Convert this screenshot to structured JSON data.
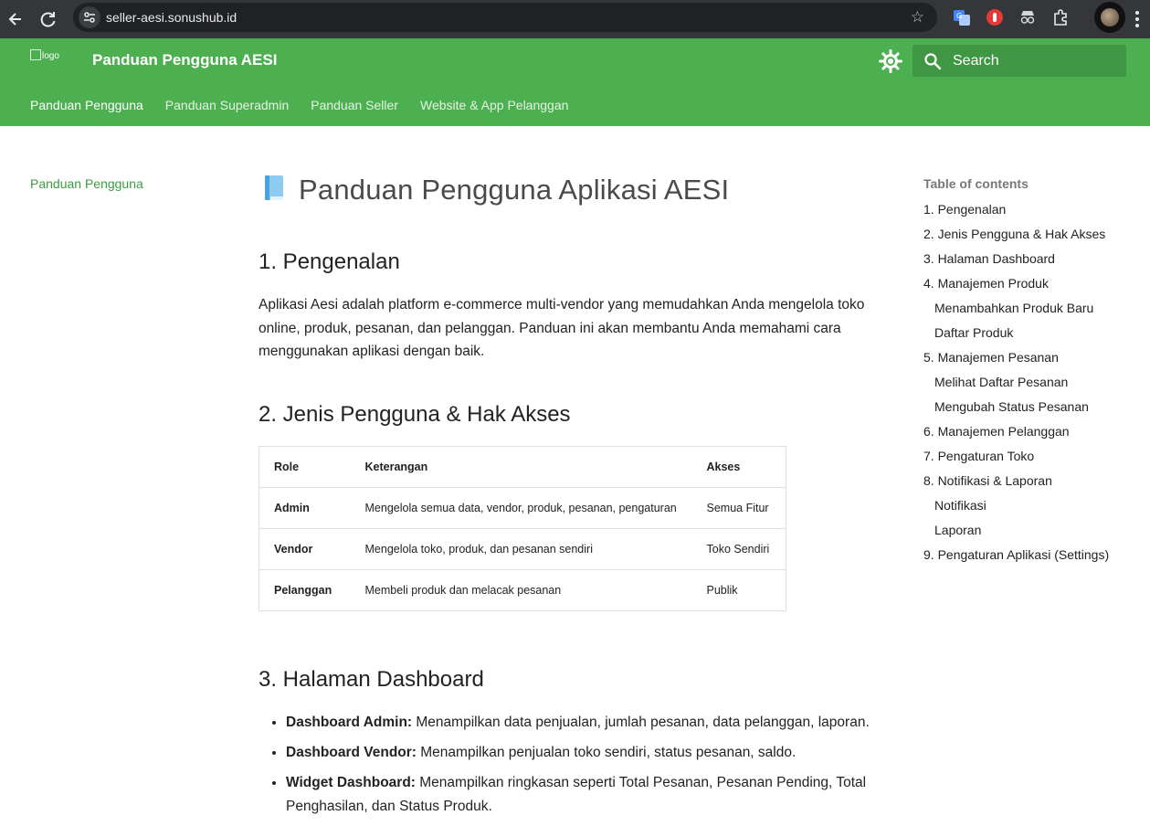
{
  "browser": {
    "url": "seller-aesi.sonushub.id"
  },
  "header": {
    "logo_alt": "logo",
    "title": "Panduan Pengguna AESI",
    "search_placeholder": "Search",
    "tabs": [
      {
        "label": "Panduan Pengguna",
        "active": true
      },
      {
        "label": "Panduan Superadmin",
        "active": false
      },
      {
        "label": "Panduan Seller",
        "active": false
      },
      {
        "label": "Website & App Pelanggan",
        "active": false
      }
    ],
    "accent_color": "#4caf50"
  },
  "leftnav": {
    "item": "Panduan Pengguna"
  },
  "content": {
    "title": "Panduan Pengguna Aplikasi AESI",
    "sections": {
      "intro_heading": "1. Pengenalan",
      "intro_text": "Aplikasi Aesi adalah platform e-commerce multi-vendor yang memudahkan Anda mengelola toko online, produk, pesanan, dan pelanggan. Panduan ini akan membantu Anda memahami cara menggunakan aplikasi dengan baik.",
      "roles_heading": "2. Jenis Pengguna & Hak Akses",
      "dashboard_heading": "3. Halaman Dashboard"
    },
    "roles_table": {
      "headers": [
        "Role",
        "Keterangan",
        "Akses"
      ],
      "rows": [
        [
          "Admin",
          "Mengelola semua data, vendor, produk, pesanan, pengaturan",
          "Semua Fitur"
        ],
        [
          "Vendor",
          "Mengelola toko, produk, dan pesanan sendiri",
          "Toko Sendiri"
        ],
        [
          "Pelanggan",
          "Membeli produk dan melacak pesanan",
          "Publik"
        ]
      ]
    },
    "dashboard_items": [
      {
        "term": "Dashboard Admin:",
        "text": " Menampilkan data penjualan, jumlah pesanan, data pelanggan, laporan."
      },
      {
        "term": "Dashboard Vendor:",
        "text": " Menampilkan penjualan toko sendiri, status pesanan, saldo."
      },
      {
        "term": "Widget Dashboard:",
        "text": " Menampilkan ringkasan seperti Total Pesanan, Pesanan Pending, Total Penghasilan, dan Status Produk."
      }
    ]
  },
  "toc": {
    "title": "Table of contents",
    "items": [
      {
        "label": "1. Pengenalan",
        "sub": false
      },
      {
        "label": "2. Jenis Pengguna & Hak Akses",
        "sub": false
      },
      {
        "label": "3. Halaman Dashboard",
        "sub": false
      },
      {
        "label": "4. Manajemen Produk",
        "sub": false
      },
      {
        "label": "Menambahkan Produk Baru",
        "sub": true
      },
      {
        "label": "Daftar Produk",
        "sub": true
      },
      {
        "label": "5. Manajemen Pesanan",
        "sub": false
      },
      {
        "label": "Melihat Daftar Pesanan",
        "sub": true
      },
      {
        "label": "Mengubah Status Pesanan",
        "sub": true
      },
      {
        "label": "6. Manajemen Pelanggan",
        "sub": false
      },
      {
        "label": "7. Pengaturan Toko",
        "sub": false
      },
      {
        "label": "8. Notifikasi & Laporan",
        "sub": false
      },
      {
        "label": "Notifikasi",
        "sub": true
      },
      {
        "label": "Laporan",
        "sub": true
      },
      {
        "label": "9. Pengaturan Aplikasi (Settings)",
        "sub": false
      }
    ]
  }
}
